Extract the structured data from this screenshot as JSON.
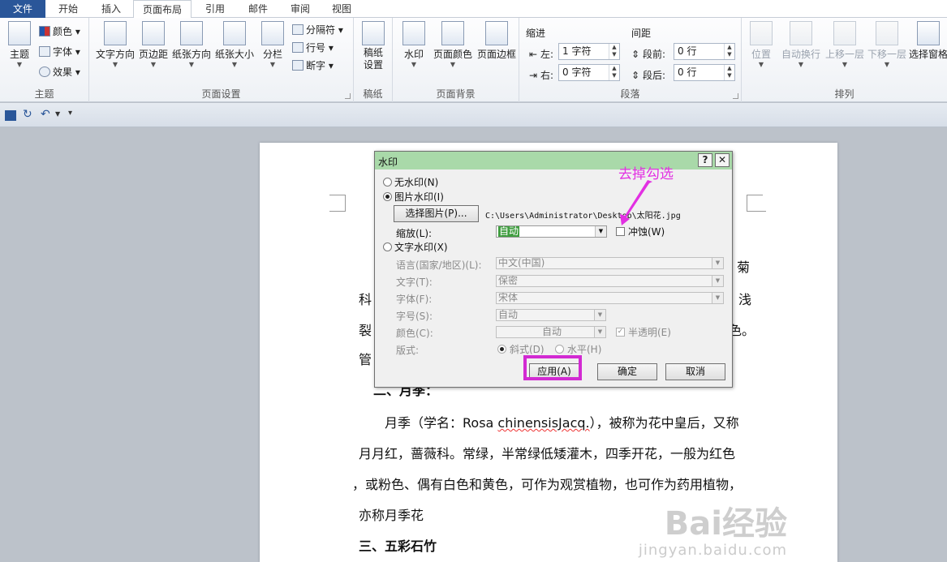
{
  "tabs": [
    "文件",
    "开始",
    "插入",
    "页面布局",
    "引用",
    "邮件",
    "审阅",
    "视图"
  ],
  "ribbon": {
    "theme": {
      "label": "主题",
      "big": "主题",
      "colors": "颜色",
      "fonts": "字体",
      "effects": "效果"
    },
    "page_setup": {
      "label": "页面设置",
      "text_direction": "文字方向",
      "margins": "页边距",
      "orientation": "纸张方向",
      "size": "纸张大小",
      "columns": "分栏",
      "breaks": "分隔符",
      "line_numbers": "行号",
      "hyphenation": "断字"
    },
    "draft": {
      "label": "稿纸",
      "btn": "稿纸\n设置"
    },
    "background": {
      "label": "页面背景",
      "watermark": "水印",
      "page_color": "页面颜色",
      "page_border": "页面边框"
    },
    "paragraph": {
      "label": "段落",
      "indent": "缩进",
      "spacing": "间距",
      "left": "左:",
      "right": "右:",
      "left_val": "1 字符",
      "right_val": "0 字符",
      "before": "段前:",
      "after": "段后:",
      "before_val": "0 行",
      "after_val": "0 行"
    },
    "arrange": {
      "label": "排列",
      "position": "位置",
      "wrap": "自动换行",
      "forward": "上移一层",
      "backward": "下移一层",
      "selection": "选择窗格"
    }
  },
  "document": {
    "lines": [
      "菊",
      "科",
      "浅",
      "裂",
      "色。",
      "管",
      "二、月季：",
      "月季（学名：Rosa chinensisJacq.），被称为花中皇后，又称",
      "月月红，蔷薇科。常绿，半常绿低矮灌木，四季开花，一般为红色",
      "，或粉色、偶有白色和黄色，可作为观赏植物，也可作为药用植物，",
      "亦称月季花",
      "三、五彩石竹"
    ],
    "latin_term": "chinensisJacq."
  },
  "dialog": {
    "title": "水印",
    "help": "?",
    "close": "✕",
    "no_watermark": "无水印(N)",
    "picture_watermark": "图片水印(I)",
    "select_picture": "选择图片(P)...",
    "picture_path": "C:\\Users\\Administrator\\Desktop\\太阳花.jpg",
    "scale_label": "缩放(L):",
    "scale_value": "自动",
    "washout": "冲蚀(W)",
    "text_watermark": "文字水印(X)",
    "language_label": "语言(国家/地区)(L):",
    "language_value": "中文(中国)",
    "text_label": "文字(T):",
    "text_value": "保密",
    "font_label": "字体(F):",
    "font_value": "宋体",
    "size_label": "字号(S):",
    "size_value": "自动",
    "color_label": "颜色(C):",
    "color_value": "自动",
    "semitransparent": "半透明(E)",
    "layout_label": "版式:",
    "diagonal": "斜式(D)",
    "horizontal": "水平(H)",
    "apply": "应用(A)",
    "ok": "确定",
    "cancel": "取消"
  },
  "annotation": {
    "text": "去掉勾选",
    "color": "#e230e2"
  },
  "watermark_brand": {
    "text": "Bai经验",
    "sub": "jingyan.baidu.com"
  }
}
